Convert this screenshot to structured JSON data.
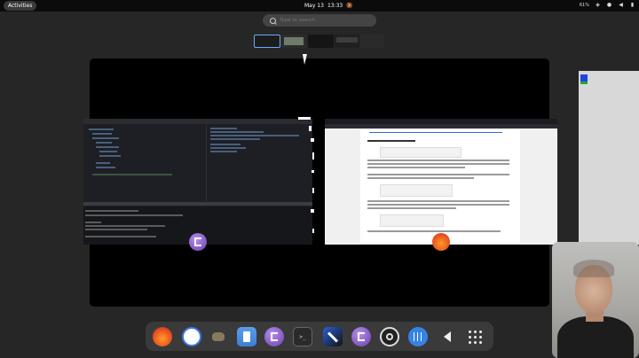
{
  "topbar": {
    "activities": "Activities",
    "date": "May 13",
    "time": "13:33",
    "battery": "61%"
  },
  "search": {
    "placeholder": "Type to search"
  },
  "colors": {
    "accent": "#6ea8ff",
    "dash_bg": "#3a3a3a",
    "emacs": "#7b4bd1",
    "firefox": "#ff7139"
  },
  "icons": {
    "dash": [
      "firefox-icon",
      "signal-icon",
      "gimp-icon",
      "files-icon",
      "emacs-icon",
      "terminal-icon",
      "crossover-icon",
      "emacs-icon",
      "obs-icon",
      "mixer-icon",
      "volume-icon",
      "app-grid-icon"
    ]
  },
  "dash": {
    "terminal_glyph": ">_"
  }
}
